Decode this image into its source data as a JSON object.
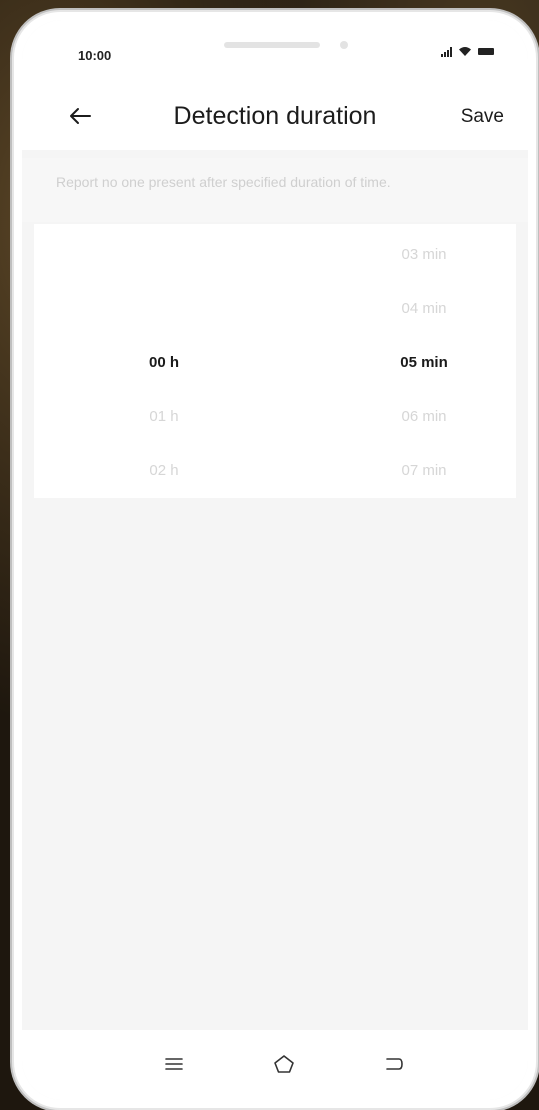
{
  "status_bar": {
    "time": "10:00",
    "icons": [
      "signal-icon",
      "wifi-icon",
      "battery-icon"
    ]
  },
  "header": {
    "back_icon": "arrow-left-icon",
    "title": "Detection duration",
    "save_label": "Save"
  },
  "description": "Report no one present after specified duration of time.",
  "picker": {
    "hours": {
      "items": [
        "00 h",
        "01 h",
        "02 h"
      ],
      "selected": "00 h"
    },
    "minutes": {
      "items": [
        "03 min",
        "04 min",
        "05 min",
        "06 min",
        "07 min"
      ],
      "selected": "05 min"
    }
  },
  "system_nav": {
    "icons": [
      "menu-icon",
      "home-icon",
      "back-icon"
    ]
  },
  "colors": {
    "screen_background": "#f5f5f5",
    "surface": "#ffffff",
    "text_primary": "#1a1a1a",
    "text_faded": "#d6d6d6"
  }
}
